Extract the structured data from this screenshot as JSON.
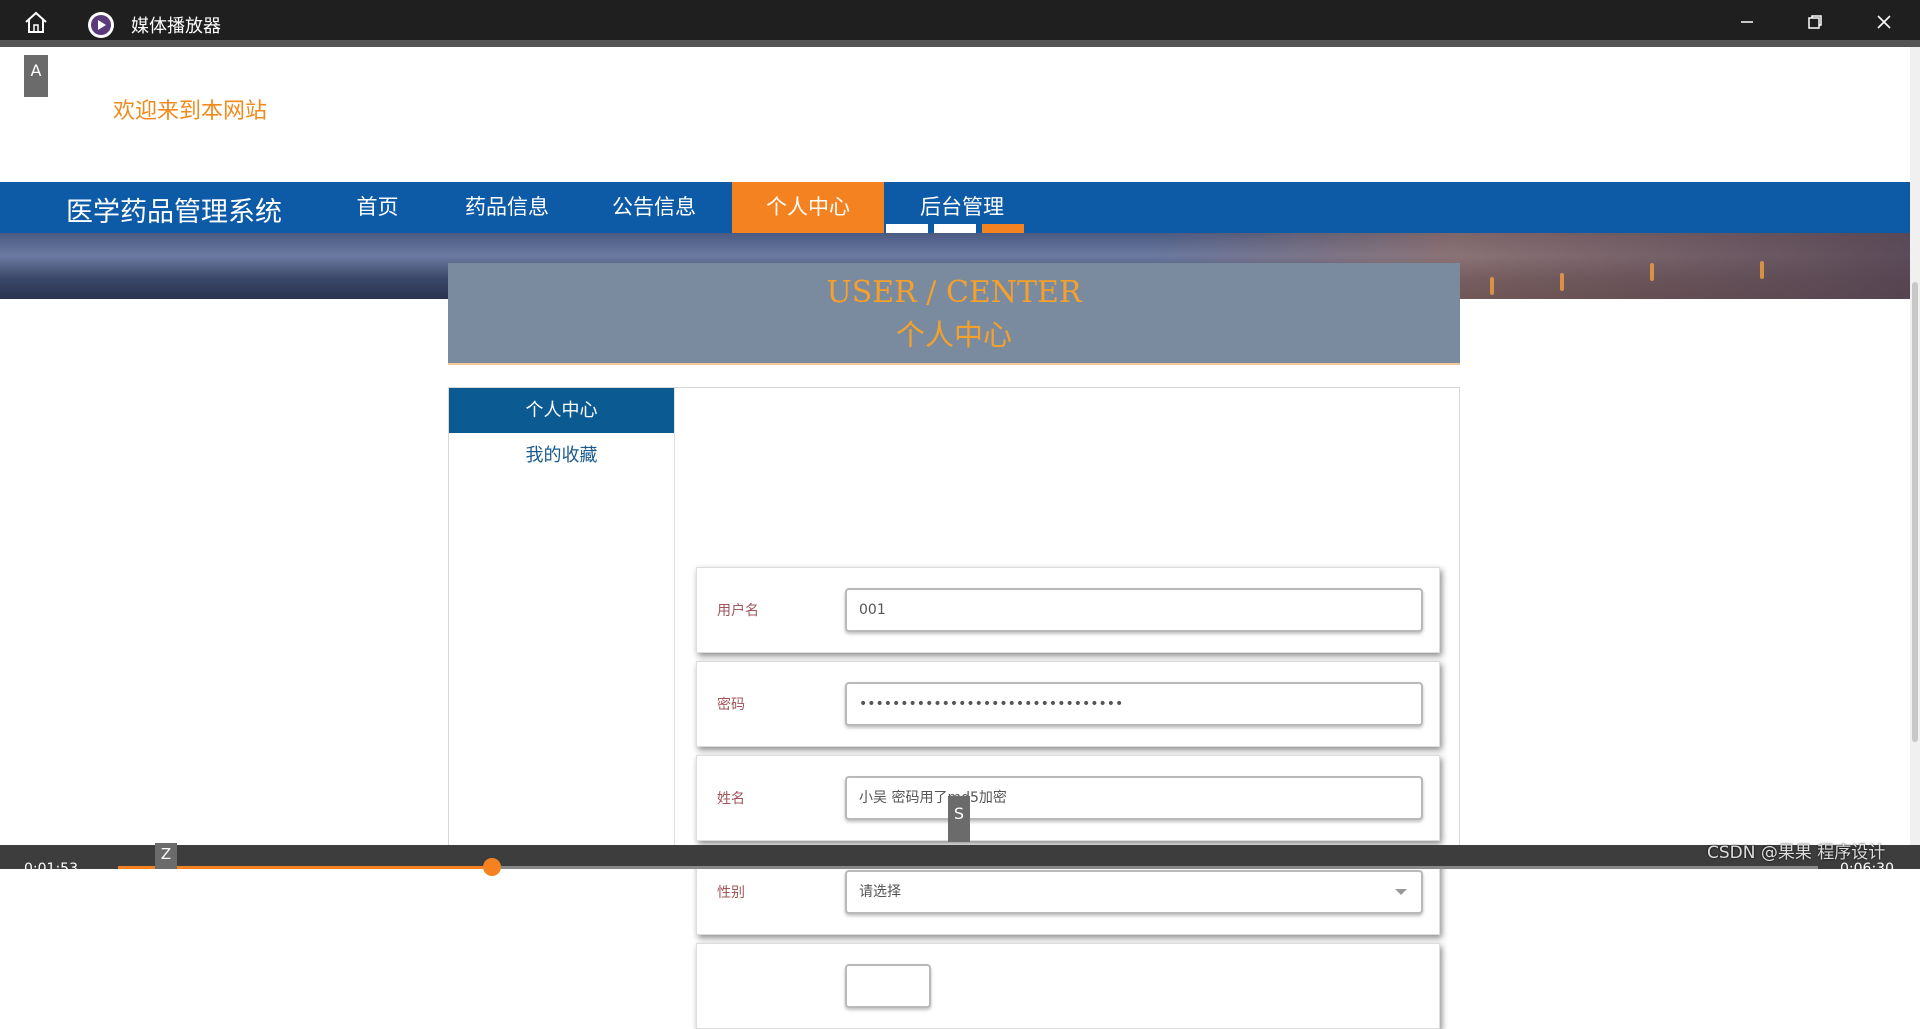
{
  "player": {
    "title": "媒体播放器",
    "time_elapsed": "0:01:53",
    "time_total": "0:06:30",
    "progress_fraction": 0.22,
    "watermark": "CSDN @果果 程序设计"
  },
  "overlay_badges": {
    "a": "A",
    "s": "S",
    "z": "Z"
  },
  "site": {
    "welcome": "欢迎来到本网站",
    "brand": "医学药品管理系统",
    "nav": [
      "首页",
      "药品信息",
      "公告信息",
      "个人中心",
      "后台管理"
    ],
    "nav_active_index": 3,
    "carousel": {
      "count": 3,
      "active_index": 2
    }
  },
  "user_center": {
    "header_en": "USER / CENTER",
    "header_cn": "个人中心",
    "side_menu": [
      "个人中心",
      "我的收藏"
    ],
    "side_active_index": 0,
    "fields": {
      "username": {
        "label": "用户名",
        "value": "001"
      },
      "password": {
        "label": "密码",
        "value": "••••••••••••••••••••••••••••••••"
      },
      "name": {
        "label": "姓名",
        "value": "小吴 密码用了md5加密"
      },
      "gender": {
        "label": "性别",
        "placeholder": "请选择"
      }
    }
  },
  "colors": {
    "nav_blue": "#0d5aa7",
    "accent_orange": "#f58220",
    "header_gray": "#7a8ba0",
    "side_active": "#0c5a92"
  }
}
